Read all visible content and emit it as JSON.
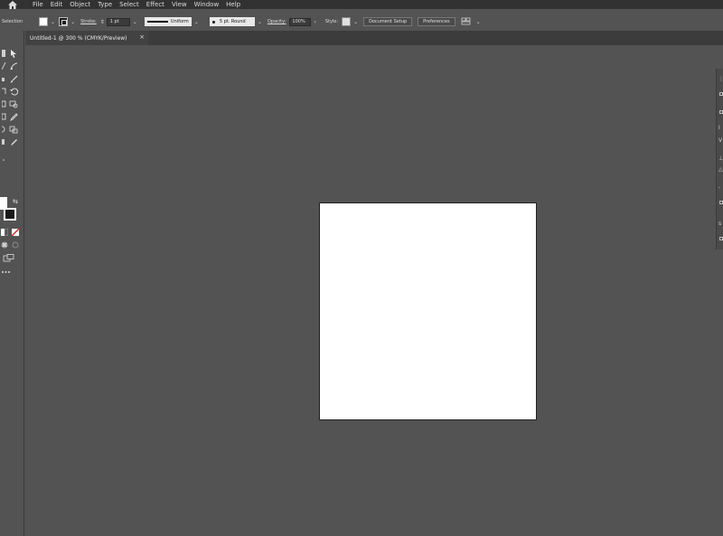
{
  "menubar": {
    "items": [
      "File",
      "Edit",
      "Object",
      "Type",
      "Select",
      "Effect",
      "View",
      "Window",
      "Help"
    ]
  },
  "controlbar": {
    "selection_label": "Selection",
    "stroke_label": "Stroke:",
    "stroke_weight": "1 pt",
    "variable_width_profile": "Uniform",
    "brush_definition": "5 pt. Round",
    "opacity_label": "Opacity:",
    "opacity_value": "100%",
    "style_label": "Style:",
    "document_setup_button": "Document Setup",
    "preferences_button": "Preferences"
  },
  "tabs": [
    {
      "label": "Untitled-1 @ 300 % (CMYK/Preview)",
      "close": "×"
    }
  ],
  "colors": {
    "app_bg": "#535353",
    "menubar_bg": "#323232",
    "artboard": "#ffffff",
    "fill_swatch": "#ffffff",
    "stroke_swatch": "#1a1a1a"
  },
  "toolbar": {
    "tools": [
      "selection-tool",
      "direct-selection-tool",
      "pen-tool",
      "curvature-tool",
      "type-tool",
      "line-tool",
      "rectangle-tool",
      "paintbrush-tool",
      "shaper-tool",
      "pencil-tool",
      "eraser-tool",
      "rotate-tool",
      "scale-tool",
      "width-tool",
      "free-transform-tool",
      "shape-builder-tool",
      "eyedropper-tool",
      "blend-tool",
      "artboard-tool",
      "hand-tool",
      "zoom-tool",
      "fill-stroke",
      "draw-mode",
      "screen-mode",
      "more-tools"
    ]
  }
}
